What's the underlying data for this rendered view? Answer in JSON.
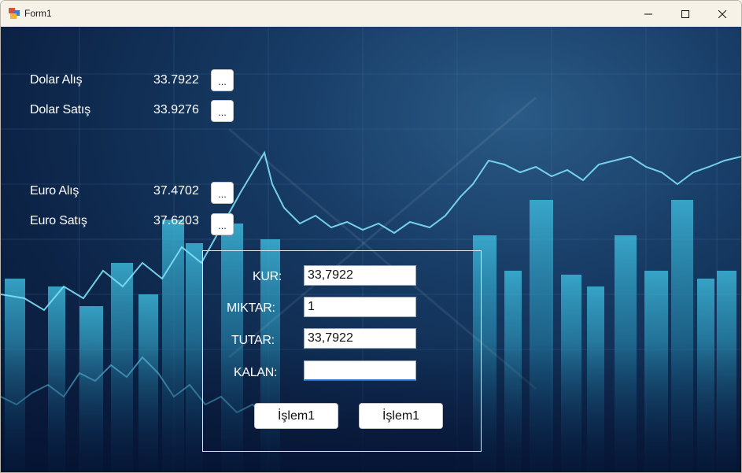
{
  "window": {
    "title": "Form1"
  },
  "rates": [
    {
      "label": "Dolar Alış",
      "value": "33.7922",
      "button": "..."
    },
    {
      "label": "Dolar Satış",
      "value": "33.9276",
      "button": "..."
    },
    {
      "label": "Euro Alış",
      "value": "37.4702",
      "button": "..."
    },
    {
      "label": "Euro Satış",
      "value": "37.6203",
      "button": "..."
    }
  ],
  "calculator": {
    "kur": {
      "label": "KUR:",
      "value": "33,7922"
    },
    "miktar": {
      "label": "MIKTAR:",
      "value": "1"
    },
    "tutar": {
      "label": "TUTAR:",
      "value": "33,7922"
    },
    "kalan": {
      "label": "KALAN:",
      "value": ""
    },
    "buttons": [
      "İşlem1",
      "İşlem1"
    ]
  },
  "colors": {
    "background_dark": "#0c2346",
    "chart_line": "#6fd3f0",
    "bars": "#2aa3c9"
  }
}
